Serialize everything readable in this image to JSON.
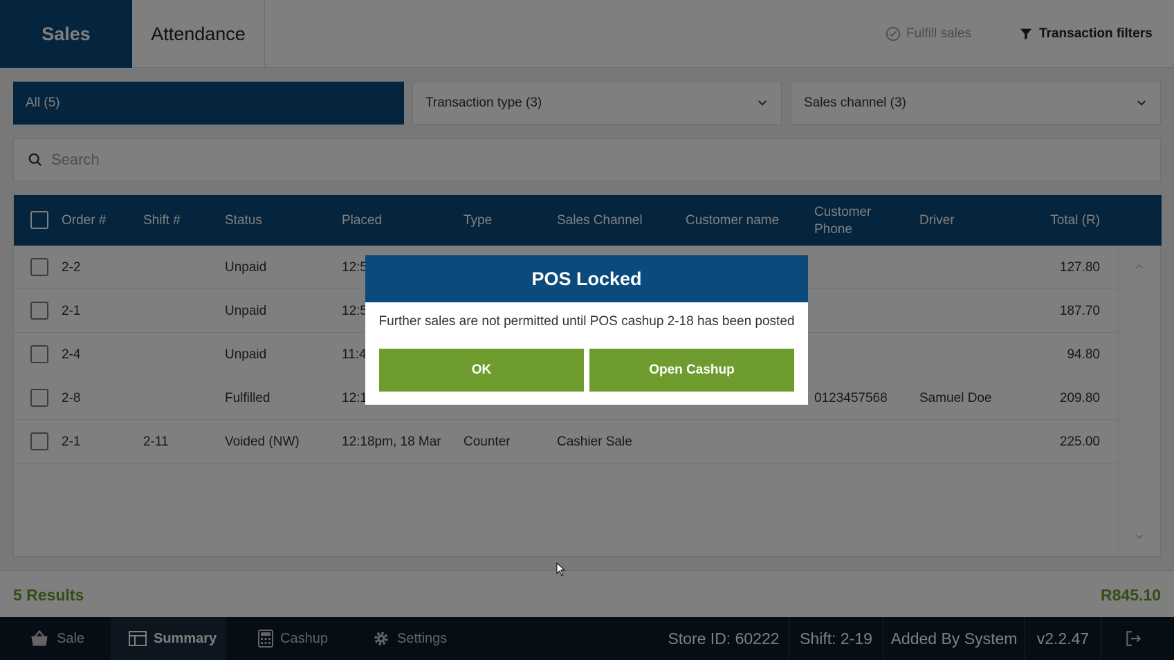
{
  "tabs": {
    "sales": "Sales",
    "attendance": "Attendance"
  },
  "actions": {
    "fulfill": "Fulfill sales",
    "filters": "Transaction filters"
  },
  "filter_row": {
    "all": "All (5)",
    "transaction_type": "Transaction type (3)",
    "sales_channel": "Sales channel (3)"
  },
  "search": {
    "placeholder": "Search"
  },
  "table": {
    "headers": {
      "order": "Order #",
      "shift": "Shift #",
      "status": "Status",
      "placed": "Placed",
      "type": "Type",
      "channel": "Sales Channel",
      "customer": "Customer name",
      "phone": "Customer Phone",
      "driver": "Driver",
      "total": "Total (R)"
    },
    "rows": [
      {
        "order": "2-2",
        "shift": "",
        "status": "Unpaid",
        "placed": "12:5",
        "type": "",
        "channel": "",
        "customer": "",
        "phone": "",
        "driver": "",
        "total": "127.80"
      },
      {
        "order": "2-1",
        "shift": "",
        "status": "Unpaid",
        "placed": "12:5",
        "type": "",
        "channel": "",
        "customer": "",
        "phone": "",
        "driver": "",
        "total": "187.70"
      },
      {
        "order": "2-4",
        "shift": "",
        "status": "Unpaid",
        "placed": "11:4",
        "type": "",
        "channel": "",
        "customer": "",
        "phone": "",
        "driver": "",
        "total": "94.80"
      },
      {
        "order": "2-8",
        "shift": "",
        "status": "Fulfilled",
        "placed": "12:1",
        "type": "",
        "channel": "",
        "customer": "",
        "phone": "0123457568",
        "driver": "Samuel Doe",
        "total": "209.80"
      },
      {
        "order": "2-1",
        "shift": "2-11",
        "status": "Voided (NW)",
        "placed": "12:18pm, 18 Mar",
        "type": "Counter",
        "channel": "Cashier Sale",
        "customer": "",
        "phone": "",
        "driver": "",
        "total": "225.00"
      }
    ]
  },
  "footer": {
    "results": "5 Results",
    "total": "R845.10"
  },
  "bottom_nav": {
    "sale": "Sale",
    "summary": "Summary",
    "cashup": "Cashup",
    "settings": "Settings"
  },
  "status_info": {
    "store": "Store ID: 60222",
    "shift": "Shift: 2-19",
    "added_by": "Added By System",
    "version": "v2.2.47"
  },
  "modal": {
    "title": "POS Locked",
    "message": "Further sales are not permitted until POS cashup 2-18 has been posted",
    "ok": "OK",
    "open_cashup": "Open Cashup"
  },
  "colors": {
    "primary": "#0b4a7d",
    "accent_green": "#6e9c2f",
    "results_green": "#6a9a2e",
    "bottom_bar": "#0e1b29"
  },
  "icons": [
    "check-circle-icon",
    "filter-icon",
    "chevron-down-icon",
    "search-icon",
    "chevron-up-icon",
    "basket-icon",
    "summary-icon",
    "calculator-icon",
    "gear-icon",
    "logout-icon"
  ]
}
